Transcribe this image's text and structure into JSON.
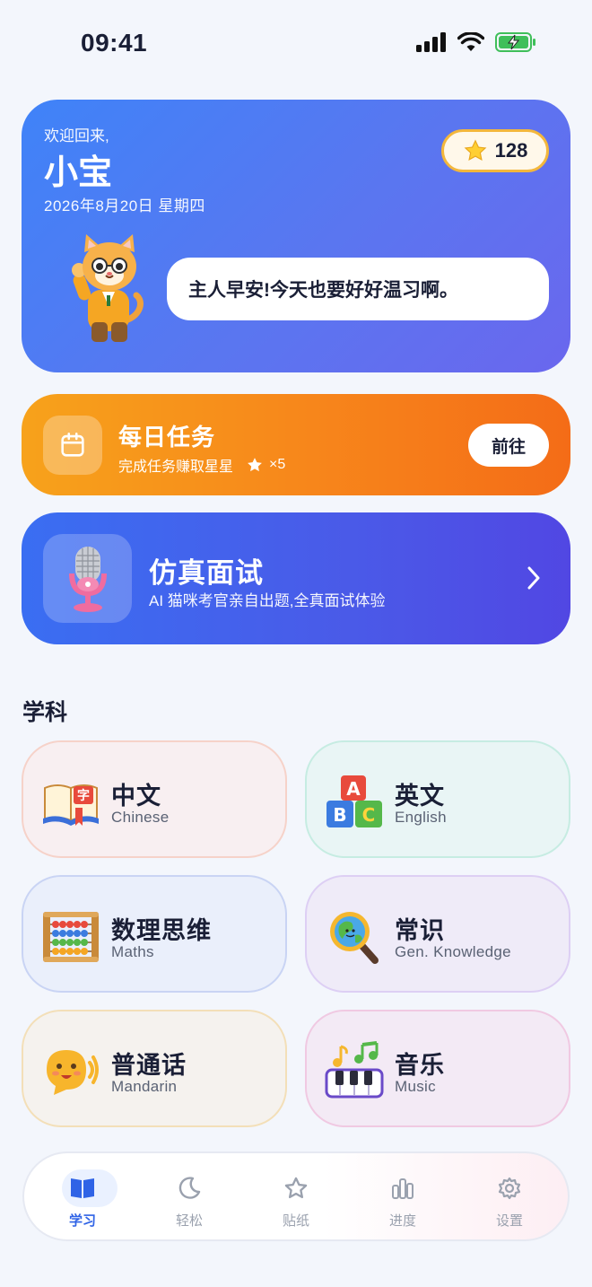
{
  "status": {
    "time": "09:41"
  },
  "welcome": {
    "greeting": "欢迎回来,",
    "name": "小宝",
    "date": "2026年8月20日 星期四",
    "stars": "128",
    "speech": "主人早安!今天也要好好温习啊。"
  },
  "daily_task": {
    "title": "每日任务",
    "subtitle": "完成任务赚取星星",
    "reward": "×5",
    "button": "前往"
  },
  "interview": {
    "title": "仿真面试",
    "subtitle": "AI 猫咪考官亲自出题,全真面试体验"
  },
  "subjects_section": {
    "title": "学科"
  },
  "subjects": [
    {
      "name": "中文",
      "en": "Chinese",
      "icon": "book-icon"
    },
    {
      "name": "英文",
      "en": "English",
      "icon": "abc-blocks-icon"
    },
    {
      "name": "数理思维",
      "en": "Maths",
      "icon": "abacus-icon"
    },
    {
      "name": "常识",
      "en": "Gen. Knowledge",
      "icon": "globe-magnifier-icon"
    },
    {
      "name": "普通话",
      "en": "Mandarin",
      "icon": "speaking-face-icon"
    },
    {
      "name": "音乐",
      "en": "Music",
      "icon": "piano-notes-icon"
    }
  ],
  "tabs": [
    {
      "label": "学习",
      "icon": "book-icon",
      "active": true
    },
    {
      "label": "轻松",
      "icon": "moon-icon"
    },
    {
      "label": "贴纸",
      "icon": "star-icon"
    },
    {
      "label": "进度",
      "icon": "bar-chart-icon"
    },
    {
      "label": "设置",
      "icon": "gear-icon"
    }
  ],
  "colors": {
    "primary": "#3f83f8",
    "orange": "#f7851b",
    "indigo": "#4a5ae8",
    "active_tab": "#2f63e6"
  }
}
